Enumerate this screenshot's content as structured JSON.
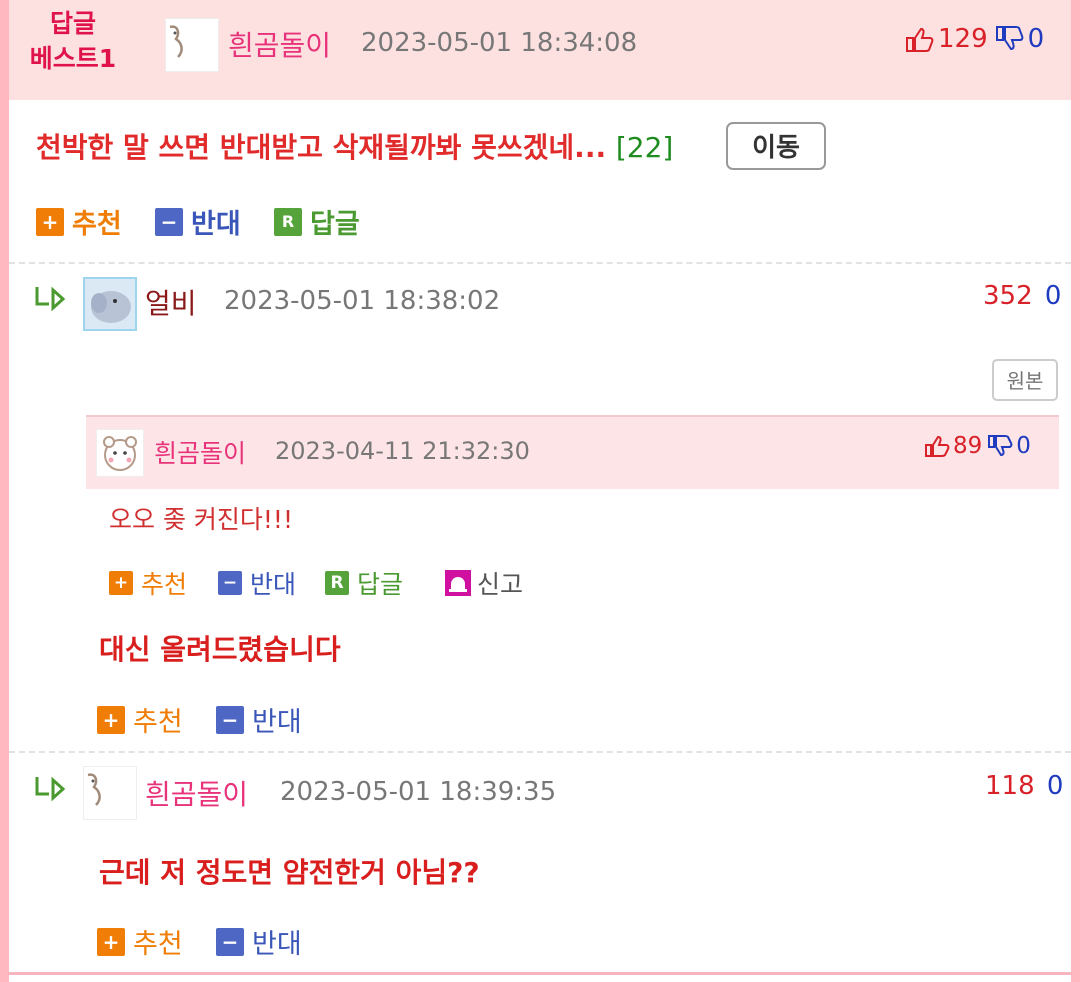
{
  "best": {
    "label_line1": "답글",
    "label_line2": "베스트1",
    "nick": "흰곰돌이",
    "date": "2023-05-01 18:34:08",
    "up": "129",
    "down": "0",
    "title": "천박한 말 쓰면 반대받고 삭재될까봐 못쓰겠네...",
    "count": "[22]",
    "move_label": "이동",
    "actions": {
      "recommend": "추천",
      "oppose": "반대",
      "reply": "답글"
    }
  },
  "reply1": {
    "nick": "얼비",
    "date": "2023-05-01 18:38:02",
    "up": "352",
    "down": "0",
    "original_label": "원본",
    "quote": {
      "nick": "흰곰돌이",
      "date": "2023-04-11 21:32:30",
      "up": "89",
      "down": "0",
      "text": "오오 좆 커진다!!!",
      "actions": {
        "recommend": "추천",
        "oppose": "반대",
        "reply": "답글",
        "report": "신고"
      }
    },
    "body": "대신 올려드렸습니다",
    "actions": {
      "recommend": "추천",
      "oppose": "반대"
    }
  },
  "reply2": {
    "nick": "흰곰돌이",
    "date": "2023-05-01 18:39:35",
    "up": "118",
    "down": "0",
    "body": "근데 저 정도면 얌전한거 아님??",
    "actions": {
      "recommend": "추천",
      "oppose": "반대"
    }
  },
  "icons": {
    "plus": "+",
    "minus": "−",
    "reply": "R"
  },
  "colors": {
    "accent_pink": "#e0124b",
    "nick_pink": "#e8337a",
    "up_red": "#d82128",
    "down_blue": "#1f3bbf",
    "best_bg": "#fde1e1"
  }
}
